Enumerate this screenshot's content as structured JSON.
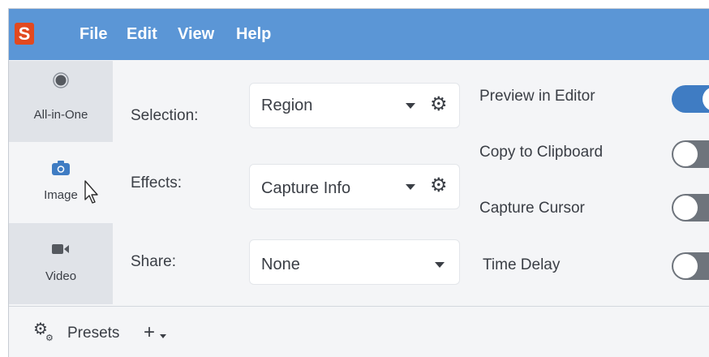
{
  "app": {
    "logo_letter": "S",
    "accent_color": "#5b96d6",
    "logo_color": "#e2491f"
  },
  "menu": {
    "items": [
      "File",
      "Edit",
      "View",
      "Help"
    ]
  },
  "tabs": [
    {
      "label": "All-in-One",
      "icon": "record-circle-icon",
      "selected": false
    },
    {
      "label": "Image",
      "icon": "camera-icon",
      "selected": true
    },
    {
      "label": "Video",
      "icon": "video-camera-icon",
      "selected": false
    }
  ],
  "settings": {
    "selection": {
      "label": "Selection:",
      "value": "Region"
    },
    "effects": {
      "label": "Effects:",
      "value": "Capture Info"
    },
    "share": {
      "label": "Share:",
      "value": "None"
    }
  },
  "options": [
    {
      "label": "Preview in Editor",
      "on": true
    },
    {
      "label": "Copy to Clipboard",
      "on": false
    },
    {
      "label": "Capture Cursor",
      "on": false
    },
    {
      "label": "Time Delay",
      "on": false
    }
  ],
  "bottom": {
    "presets_label": "Presets",
    "add_symbol": "+"
  }
}
